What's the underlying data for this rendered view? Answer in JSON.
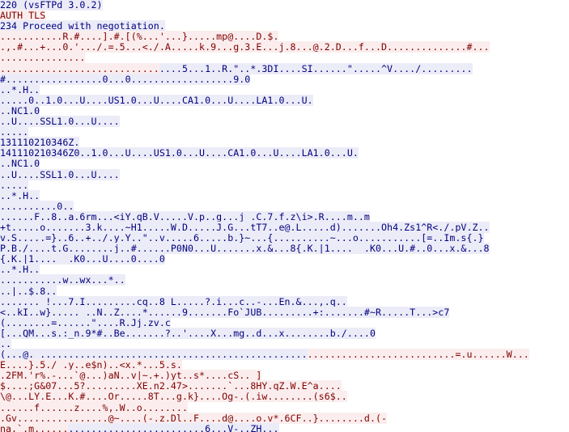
{
  "window": {
    "content_type": "tcp-stream-follow",
    "colors": {
      "server_text": "#00007f",
      "server_bg": "#ececf8",
      "client_text": "#7f0000",
      "client_bg": "#fbeded"
    }
  },
  "stream": {
    "lines": [
      [
        {
          "dir": "server",
          "text": "220 (vsFTPd 3.0.2)"
        }
      ],
      [
        {
          "dir": "client",
          "text": "AUTH TLS"
        }
      ],
      [
        {
          "dir": "server",
          "text": "234 Proceed with negotiation."
        }
      ],
      [
        {
          "dir": "client",
          "text": "...........R.#....].#.[(%...'...}.....mp@....D.$."
        }
      ],
      [
        {
          "dir": "client",
          "text": ".,.#...+...0.'.../.=.5...<./.A.....k.9...g.3.E...j.8...@.2.D...f...D..............#..."
        }
      ],
      [
        {
          "dir": "client",
          "text": "..............."
        }
      ],
      [
        {
          "dir": "client",
          "text": "............................"
        },
        {
          "dir": "server",
          "text": "....5...1..R.\"..*.3DI....SI......\".....^V..../........."
        }
      ],
      [
        {
          "dir": "server",
          "text": "#.................0...0..................9.0"
        }
      ],
      [
        {
          "dir": "server",
          "text": "..*.H.."
        }
      ],
      [
        {
          "dir": "server",
          "text": ".....0..1.0...U....US1.0...U....CA1.0...U....LA1.0...U."
        }
      ],
      [
        {
          "dir": "server",
          "text": "..NC1.0"
        }
      ],
      [
        {
          "dir": "server",
          "text": "..U....SSL1.0...U...."
        }
      ],
      [
        {
          "dir": "server",
          "text": "....."
        }
      ],
      [
        {
          "dir": "server",
          "text": "131110210346Z."
        }
      ],
      [
        {
          "dir": "server",
          "text": "141110210346Z0..1.0...U....US1.0...U....CA1.0...U....LA1.0...U."
        }
      ],
      [
        {
          "dir": "server",
          "text": "..NC1.0"
        }
      ],
      [
        {
          "dir": "server",
          "text": "..U....SSL1.0...U...."
        }
      ],
      [
        {
          "dir": "server",
          "text": "....."
        }
      ],
      [
        {
          "dir": "server",
          "text": "..*.H.."
        }
      ],
      [
        {
          "dir": "server",
          "text": "..........0.."
        }
      ],
      [
        {
          "dir": "server",
          "text": "......F..8..a.6rm...<iY.qB.V.....V.p..g...j_.C.7.f.z\\i>.R....m..m"
        }
      ],
      [
        {
          "dir": "server",
          "text": "+t.....o.......3.k....~H1.....W.D.....J.G...tT7..e@.L.....d).......Oh4.Zs1^R<./.pV.Z.."
        }
      ],
      [
        {
          "dir": "server",
          "text": "v.S.....=}..6..+../.y.Y..\"..v.....6.....b.}~...{..........~...o...........[=..Im.s{.}"
        }
      ],
      [
        {
          "dir": "server",
          "text": "P.B./....t.G........j..#......P0N0...U.......x.&...8{.K.|1....  .K0...U.#..0...x.&...8"
        }
      ],
      [
        {
          "dir": "server",
          "text": "{.K.|1....  .K0...U....0....0"
        }
      ],
      [
        {
          "dir": "server",
          "text": "..*.H.."
        }
      ],
      [
        {
          "dir": "server",
          "text": "...........w..wx...*.."
        }
      ],
      [
        {
          "dir": "server",
          "text": "..|..$.8.."
        }
      ],
      [
        {
          "dir": "server",
          "text": "....... !...7.I.........cq..8 L.....?.i...c..-...En.&...,.q.."
        }
      ],
      [
        {
          "dir": "server",
          "text": "<..kI..w}....._..N..Z....*......9.......Fo`JUB.........+:.......#~R.....T...>c7"
        }
      ],
      [
        {
          "dir": "server",
          "text": "(........=......\"....R.Jj.zv.c"
        }
      ],
      [
        {
          "dir": "server",
          "text": "[...QM...s.:_n.9*#..Be.......?..'....X...mg..d...x........b./....0"
        }
      ],
      [
        {
          "dir": "server",
          "text": ".."
        }
      ],
      [
        {
          "dir": "server",
          "text": "(...@. ..............................................."
        },
        {
          "dir": "client",
          "text": "..........................=.u......W..."
        }
      ],
      [
        {
          "dir": "client",
          "text": "E....}.5./_.y..e$n)..<x.*...5.s."
        }
      ],
      [
        {
          "dir": "client",
          "text": ".2FM.'r%.-...`@...)aN..v|~.+.)yt..s*....cS.. ]"
        }
      ],
      [
        {
          "dir": "client",
          "text": "$....;G&07...5?.........XE.n2.47>.......`...8HY.qZ.W.E^a...."
        }
      ],
      [
        {
          "dir": "client",
          "text": "\\@...LY.E...K.#....Or.....8T...g.k}....Og-.(.iw........(s6$.."
        }
      ],
      [
        {
          "dir": "client",
          "text": "......f......z....%,.W..o........"
        }
      ],
      [
        {
          "dir": "client",
          "text": ".Gv................@~....(-.z.Dl..F....d@....o.v*.6CF..}........d.(-"
        }
      ],
      [
        {
          "dir": "client",
          "text": "na,`.m......"
        },
        {
          "dir": "server",
          "text": "........................6...V-..ZH..."
        }
      ]
    ]
  }
}
